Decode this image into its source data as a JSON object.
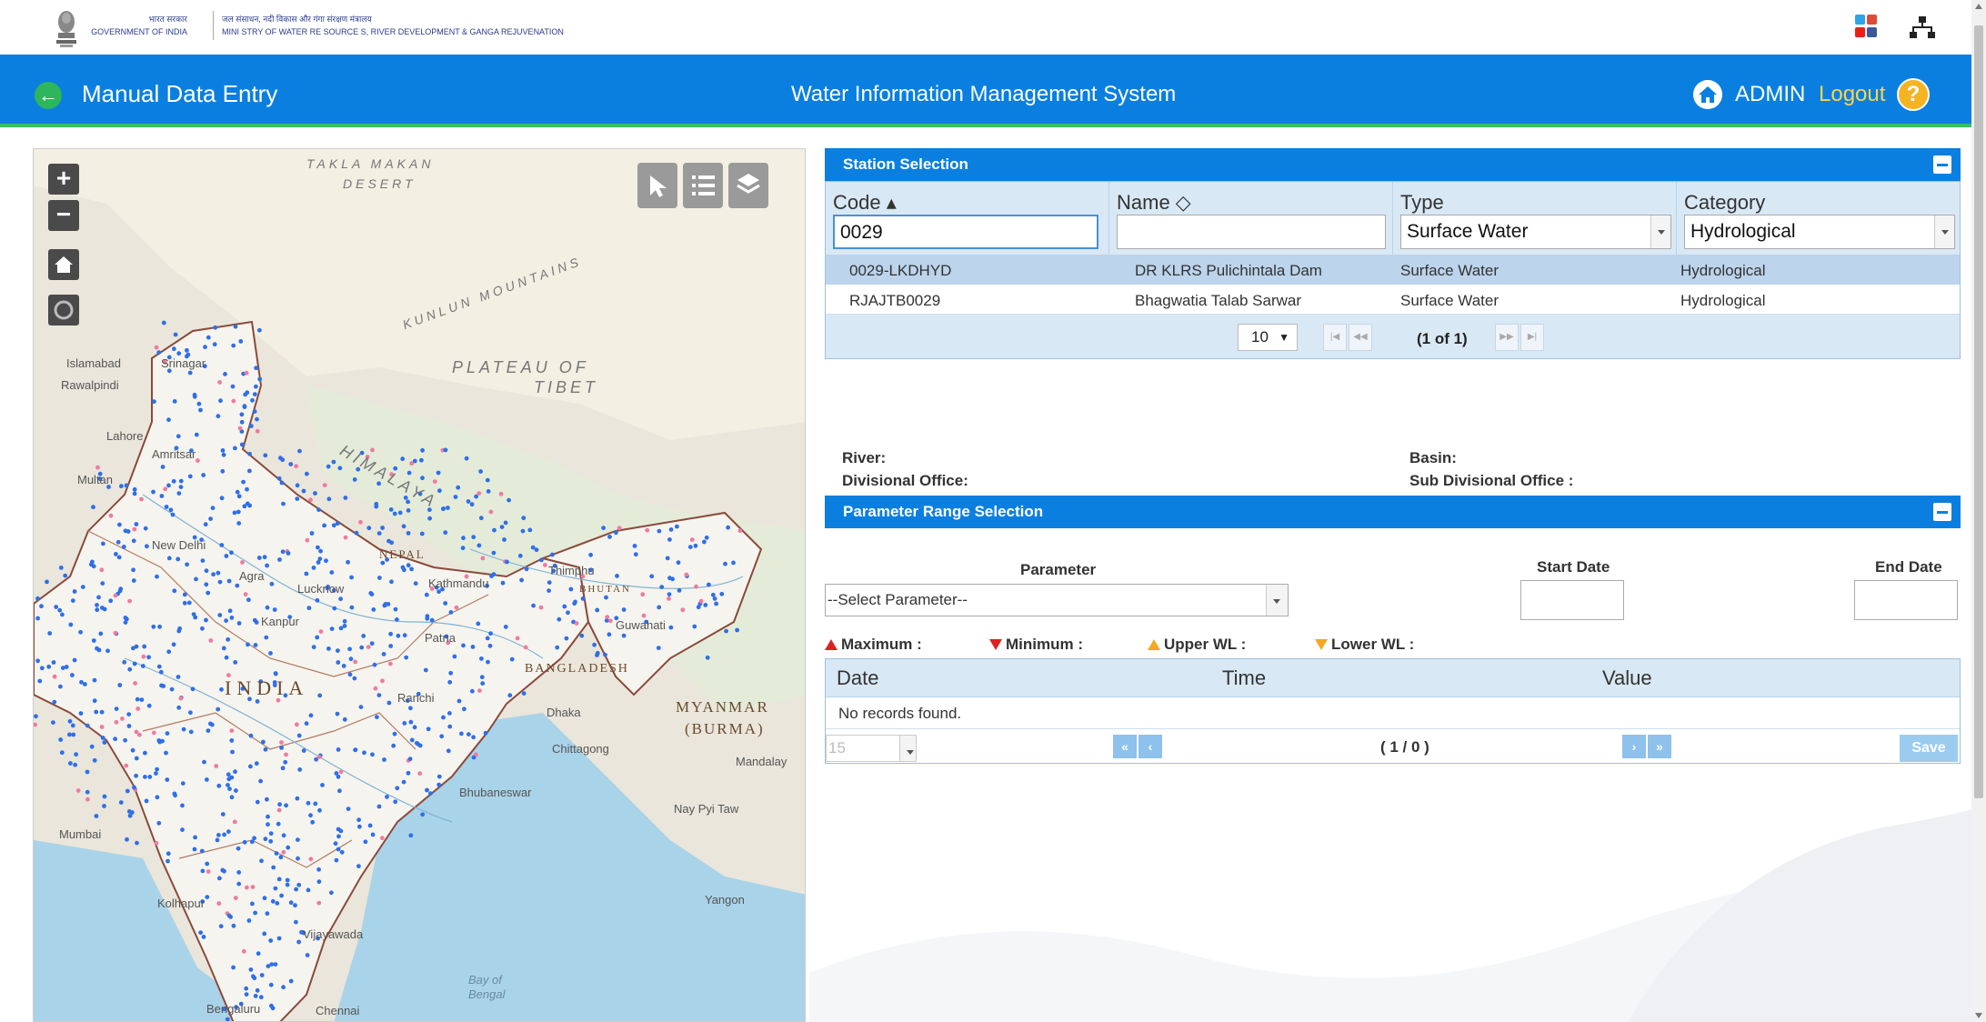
{
  "gov": {
    "hindi_gov": "भारत सरकार",
    "english_gov": "GOVERNMENT OF INDIA",
    "hindi_ministry": "जल संसाधन, नदी विकास और गंगा संरक्षण मंत्रालय",
    "english_ministry": "MINI STRY OF WATER RE SOURCE S, RIVER DEVELOPMENT & GANGA REJUVENATION"
  },
  "header": {
    "page_name": "Manual Data Entry",
    "app_title": "Water Information Management System",
    "user": "ADMIN",
    "logout": "Logout",
    "help": "?"
  },
  "map": {
    "labels": {
      "takla": "TAKLA MAKAN",
      "desert": "DESERT",
      "kunlun": "KUNLUN MOUNTAINS",
      "plateau": "PLATEAU OF",
      "tibet": "TIBET",
      "himalaya": "HIMALAYA",
      "islamabad": "Islamabad",
      "rawalpindi": "Rawalpindi",
      "srinagar": "Srinagar",
      "lahore": "Lahore",
      "amritsar": "Amritsar",
      "multan": "Multan",
      "new_delhi": "New Delhi",
      "agra": "Agra",
      "lucknow": "Lucknow",
      "kanpur": "Kanpur",
      "kathmandu": "Kathmandu",
      "nepal": "NEPAL",
      "thimphu": "Thimphu",
      "bhutan": "BHUTAN",
      "guwahati": "Guwahati",
      "patna": "Patna",
      "bangladesh": "BANGLADESH",
      "india": "INDIA",
      "ranchi": "Ranchi",
      "dhaka": "Dhaka",
      "myanmar": "MYANMAR",
      "burma": "(BURMA)",
      "chittagong": "Chittagong",
      "mandalay": "Mandalay",
      "bhubaneswar": "Bhubaneswar",
      "nay_pyi_taw": "Nay Pyi Taw",
      "mumbai": "Mumbai",
      "yangon": "Yangon",
      "vijayawada": "Vijayawada",
      "kolhapur": "Kolhapur",
      "bay": "Bay of",
      "bengal": "Bengal",
      "chennai": "Chennai",
      "bengaluru": "Bengaluru"
    }
  },
  "station_selection": {
    "title": "Station Selection",
    "columns": {
      "code": "Code ▴",
      "name": "Name ◇",
      "type": "Type",
      "category": "Category"
    },
    "filters": {
      "code": "0029",
      "name": "",
      "type": "Surface Water",
      "category": "Hydrological"
    },
    "rows": [
      {
        "code": "0029-LKDHYD",
        "name": "DR KLRS Pulichintala Dam",
        "type": "Surface Water",
        "category": "Hydrological"
      },
      {
        "code": "RJAJTB0029",
        "name": "Bhagwatia Talab Sarwar",
        "type": "Surface Water",
        "category": "Hydrological"
      }
    ],
    "rows_per_page": "10",
    "page_info": "(1 of 1)"
  },
  "info": {
    "river": "River:",
    "basin": "Basin:",
    "divisional_office": "Divisional Office:",
    "sub_divisional_office": "Sub Divisional Office :"
  },
  "parameter_range": {
    "title": "Parameter Range Selection",
    "parameter_label": "Parameter",
    "start_date_label": "Start Date",
    "end_date_label": "End Date",
    "parameter_value": "--Select Parameter--",
    "legend": {
      "maximum": "Maximum :",
      "minimum": "Minimum :",
      "upper_wl": "Upper WL :",
      "lower_wl": "Lower WL :"
    },
    "colors": {
      "maximum": "#e02020",
      "minimum": "#e02020",
      "upper_wl": "#f5a623",
      "lower_wl": "#f5a623"
    }
  },
  "records": {
    "columns": {
      "date": "Date",
      "time": "Time",
      "value": "Value"
    },
    "empty": "No records found.",
    "rows_per_page": "15",
    "count": "( 1 / 0 )",
    "save": "Save"
  }
}
